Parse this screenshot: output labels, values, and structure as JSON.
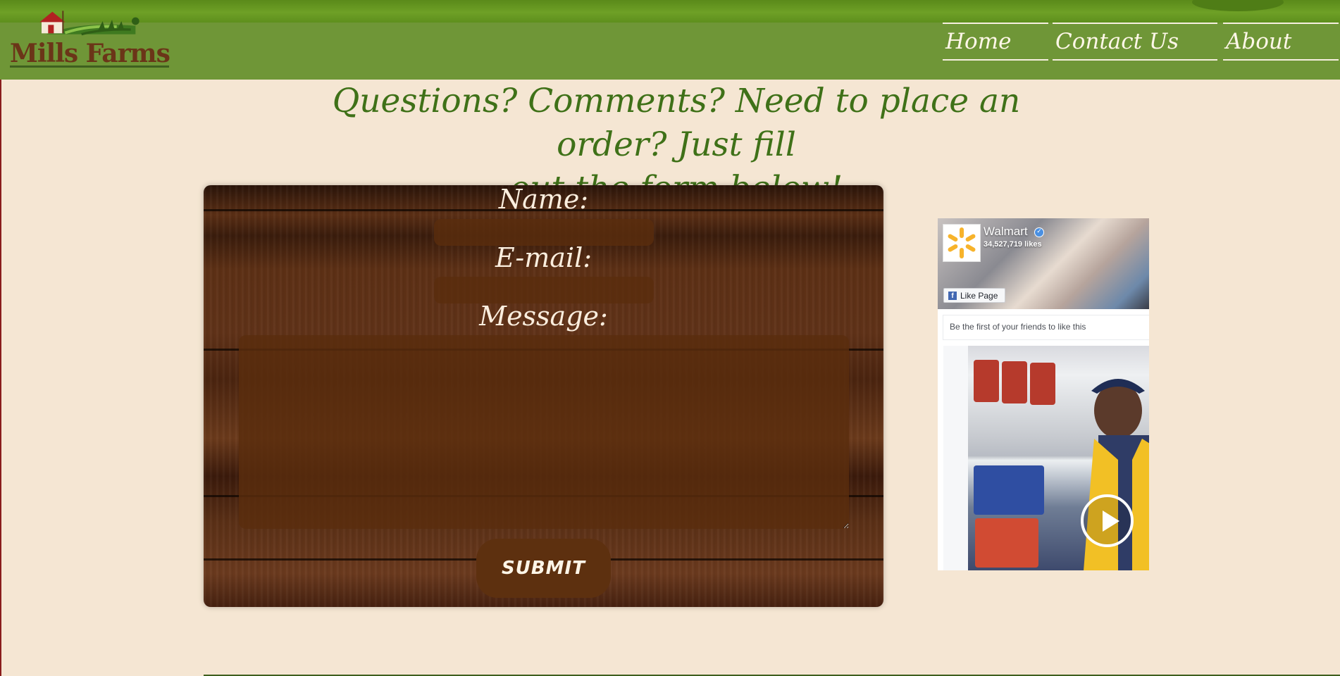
{
  "header": {
    "logo_text": "Mills Farms",
    "nav": [
      "Home",
      "Contact Us",
      "About"
    ]
  },
  "headline": {
    "line1": "Questions? Comments? Need to place an order? Just fill",
    "line2": "out the form below!"
  },
  "form": {
    "name_label": "Name:",
    "name_value": "",
    "email_label": "E-mail:",
    "email_value": "",
    "message_label": "Message:",
    "message_value": "",
    "submit_label": "SUBMIT"
  },
  "facebook": {
    "page_name": "Walmart",
    "likes_text": "34,527,719 likes",
    "like_button": "Like Page",
    "friends_text": "Be the first of your friends to like this"
  },
  "colors": {
    "background": "#f5e6d3",
    "header_green": "#6f9637",
    "headline_green": "#3f7118",
    "brand_brown": "#6b3518",
    "submit_brown": "#5d300f"
  },
  "icons": [
    "barn-logo-icon",
    "verified-badge-icon",
    "facebook-f-icon",
    "play-icon"
  ]
}
